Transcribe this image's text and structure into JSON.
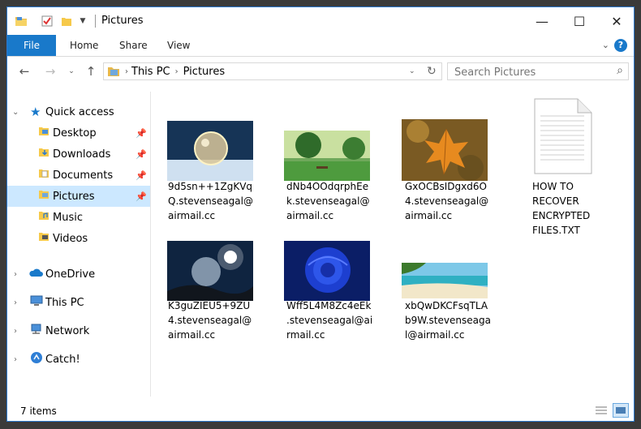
{
  "window": {
    "title": "Pictures",
    "minimize_glyph": "—",
    "maximize_glyph": "☐",
    "close_glyph": "✕"
  },
  "ribbon": {
    "tabs": [
      "File",
      "Home",
      "Share",
      "View"
    ],
    "help_glyph": "?"
  },
  "address": {
    "crumbs": [
      "This PC",
      "Pictures"
    ],
    "search_placeholder": "Search Pictures"
  },
  "nav": {
    "quick_access": "Quick access",
    "items": [
      {
        "label": "Desktop",
        "icon": "desktop-folder-icon",
        "pinned": true
      },
      {
        "label": "Downloads",
        "icon": "downloads-folder-icon",
        "pinned": true
      },
      {
        "label": "Documents",
        "icon": "documents-folder-icon",
        "pinned": true
      },
      {
        "label": "Pictures",
        "icon": "pictures-folder-icon",
        "pinned": true,
        "selected": true
      },
      {
        "label": "Music",
        "icon": "music-folder-icon",
        "pinned": false
      },
      {
        "label": "Videos",
        "icon": "videos-folder-icon",
        "pinned": false
      }
    ],
    "roots": [
      "OneDrive",
      "This PC",
      "Network",
      "Catch!"
    ]
  },
  "files": [
    {
      "name": "9d5sn++1ZgKVqQ.stevenseagal@airmail.cc",
      "lines": [
        "9d5sn++1ZgKVq",
        "Q.stevenseagal@",
        "airmail.cc"
      ],
      "thumb": "frozen-bubble"
    },
    {
      "name": "dNb4OOdqrphEek.stevenseagal@airmail.cc",
      "lines": [
        "dNb4OOdqrphEe",
        "k.stevenseagal@",
        "airmail.cc"
      ],
      "thumb": "green-field-tree"
    },
    {
      "name": "GxOCBsIDgxd6O4.stevenseagal@airmail.cc",
      "lines": [
        "GxOCBsIDgxd6O",
        "4.stevenseagal@",
        "airmail.cc"
      ],
      "thumb": "autumn-leaf"
    },
    {
      "name": "HOW TO RECOVER ENCRYPTED FILES.TXT",
      "lines": [
        "HOW TO",
        "RECOVER",
        "ENCRYPTED",
        "FILES.TXT"
      ],
      "thumb": "text-document"
    },
    {
      "name": "K3guZIEU5+9ZU4.stevenseagal@airmail.cc",
      "lines": [
        "K3guZIEU5+9ZU",
        "4.stevenseagal@",
        "airmail.cc"
      ],
      "thumb": "moon-bubble"
    },
    {
      "name": "Wff5L4M8Zc4eEk.stevenseagal@airmail.cc",
      "lines": [
        "Wff5L4M8Zc4eEk",
        ".stevenseagal@ai",
        "rmail.cc"
      ],
      "thumb": "blue-rose"
    },
    {
      "name": "xbQwDKCFsqTLAb9W.stevenseagal@airmail.cc",
      "lines": [
        "xbQwDKCFsqTLA",
        "b9W.stevenseaga",
        "l@airmail.cc"
      ],
      "thumb": "tropical-beach"
    }
  ],
  "status": {
    "count": "7 items"
  },
  "colors": {
    "accent": "#1979ca",
    "selection": "#cce8ff",
    "window_border": "#2b79d0"
  }
}
